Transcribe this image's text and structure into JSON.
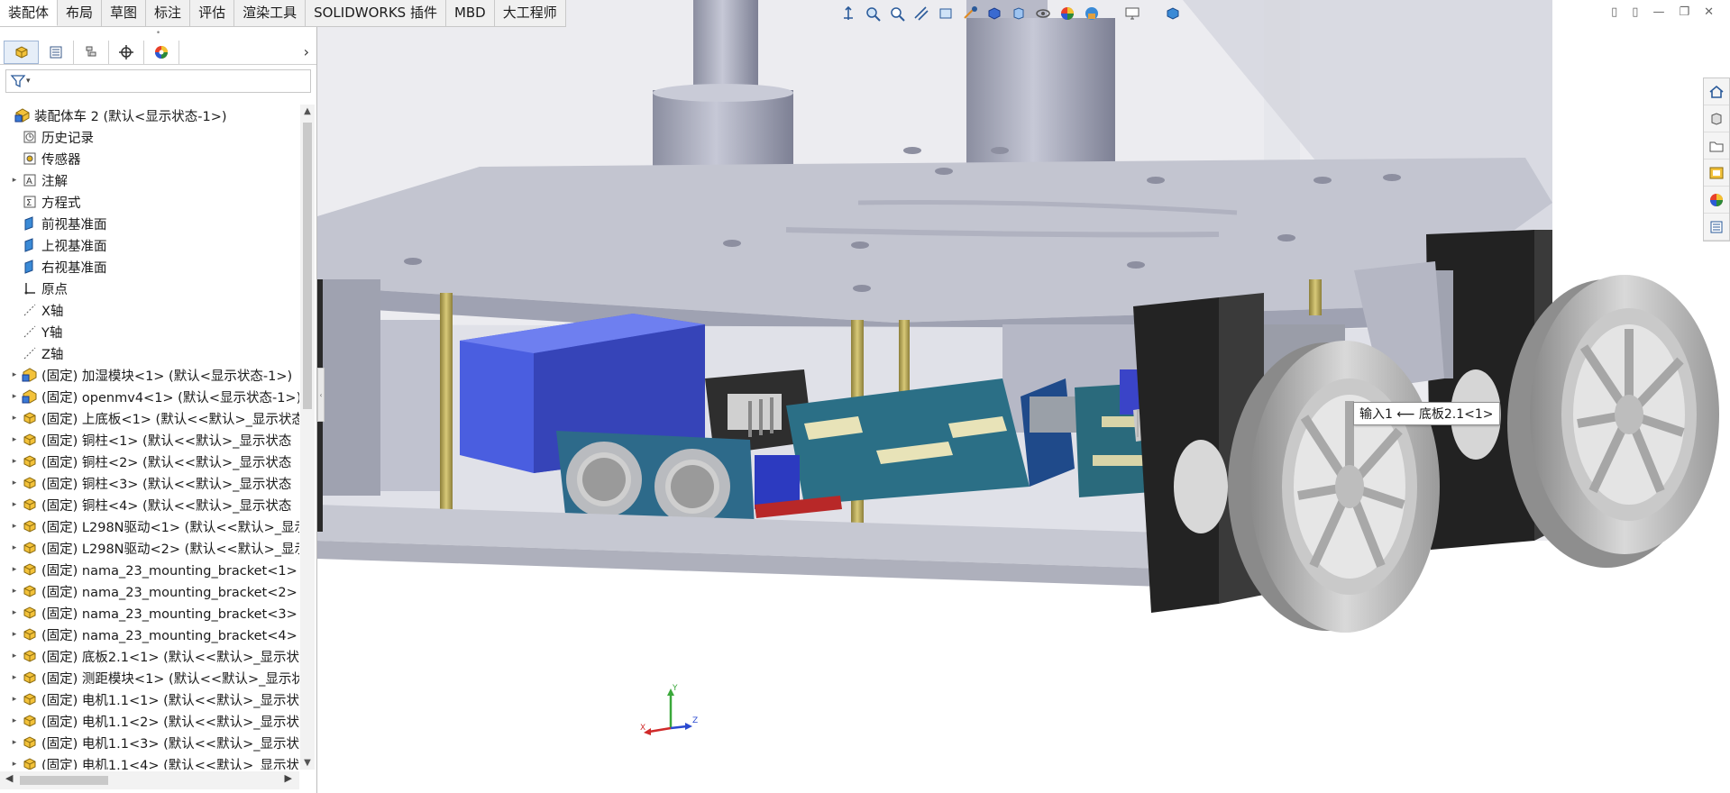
{
  "command_tabs": [
    "装配体",
    "布局",
    "草图",
    "标注",
    "评估",
    "渲染工具",
    "SOLIDWORKS 插件",
    "MBD",
    "大工程师"
  ],
  "active_tab": "装配体",
  "panel_tabs": [
    "feature-manager",
    "property-manager",
    "configuration-manager",
    "dimxpert-manager",
    "display-manager"
  ],
  "tree": {
    "root": "装配体车 2  (默认<显示状态-1>)",
    "items": [
      {
        "label": "历史记录",
        "icon": "history-icon",
        "expandable": false
      },
      {
        "label": "传感器",
        "icon": "sensor-icon",
        "expandable": false
      },
      {
        "label": "注解",
        "icon": "annotation-icon",
        "expandable": true
      },
      {
        "label": "方程式",
        "icon": "equation-icon",
        "expandable": false
      },
      {
        "label": "前视基准面",
        "icon": "plane-icon",
        "expandable": false
      },
      {
        "label": "上视基准面",
        "icon": "plane-icon",
        "expandable": false
      },
      {
        "label": "右视基准面",
        "icon": "plane-icon",
        "expandable": false
      },
      {
        "label": "原点",
        "icon": "origin-icon",
        "expandable": false
      },
      {
        "label": "X轴",
        "icon": "axis-icon",
        "expandable": false
      },
      {
        "label": "Y轴",
        "icon": "axis-icon",
        "expandable": false
      },
      {
        "label": "Z轴",
        "icon": "axis-icon",
        "expandable": false
      },
      {
        "label": "(固定) 加湿模块<1> (默认<显示状态-1>)",
        "icon": "subassembly-icon",
        "expandable": true
      },
      {
        "label": "(固定) openmv4<1> (默认<显示状态-1>)",
        "icon": "subassembly-icon",
        "expandable": true
      },
      {
        "label": "(固定) 上底板<1> (默认<<默认>_显示状态",
        "icon": "part-icon",
        "expandable": true
      },
      {
        "label": "(固定) 铜柱<1> (默认<<默认>_显示状态",
        "icon": "part-icon",
        "expandable": true
      },
      {
        "label": "(固定) 铜柱<2> (默认<<默认>_显示状态",
        "icon": "part-icon",
        "expandable": true
      },
      {
        "label": "(固定) 铜柱<3> (默认<<默认>_显示状态",
        "icon": "part-icon",
        "expandable": true
      },
      {
        "label": "(固定) 铜柱<4> (默认<<默认>_显示状态",
        "icon": "part-icon",
        "expandable": true
      },
      {
        "label": "(固定) L298N驱动<1> (默认<<默认>_显示",
        "icon": "part-icon",
        "expandable": true
      },
      {
        "label": "(固定) L298N驱动<2> (默认<<默认>_显示",
        "icon": "part-icon",
        "expandable": true
      },
      {
        "label": "(固定) nama_23_mounting_bracket<1>",
        "icon": "part-icon",
        "expandable": true
      },
      {
        "label": "(固定) nama_23_mounting_bracket<2>",
        "icon": "part-icon",
        "expandable": true
      },
      {
        "label": "(固定) nama_23_mounting_bracket<3>",
        "icon": "part-icon",
        "expandable": true
      },
      {
        "label": "(固定) nama_23_mounting_bracket<4>",
        "icon": "part-icon",
        "expandable": true
      },
      {
        "label": "(固定) 底板2.1<1> (默认<<默认>_显示状",
        "icon": "part-icon",
        "expandable": true
      },
      {
        "label": "(固定) 测距模块<1> (默认<<默认>_显示状",
        "icon": "part-icon",
        "expandable": true
      },
      {
        "label": "(固定) 电机1.1<1> (默认<<默认>_显示状",
        "icon": "part-icon",
        "expandable": true
      },
      {
        "label": "(固定) 电机1.1<2> (默认<<默认>_显示状",
        "icon": "part-icon",
        "expandable": true
      },
      {
        "label": "(固定) 电机1.1<3> (默认<<默认>_显示状",
        "icon": "part-icon",
        "expandable": true
      },
      {
        "label": "(固定) 电机1.1<4> (默认<<默认>_显示状",
        "icon": "part-icon",
        "expandable": true
      }
    ]
  },
  "tooltip": "输入1 ⟵ 底板2.1<1>",
  "triad": {
    "x": "X",
    "y": "Y",
    "z": "Z"
  },
  "heads_up_toolbar": [
    "zoom-to-fit-icon",
    "zoom-area-icon",
    "previous-view-icon",
    "section-view-icon",
    "dynamic-annotation-icon",
    "view-orientation-icon",
    "display-style-icon",
    "hide-show-icon",
    "edit-appearance-icon",
    "apply-scene-icon",
    "view-settings-icon",
    "display-pane-icon"
  ],
  "task_pane": [
    "home-icon",
    "design-library-icon",
    "file-explorer-icon",
    "view-palette-icon",
    "appearances-icon",
    "custom-properties-icon"
  ],
  "colors": {
    "accent": "#1f6fd1",
    "chassis": "#c8cad4",
    "wheel": "#bdbdbd",
    "sensor_board": "#2d6a8a",
    "blue_box": "#3b4fd6",
    "standoff": "#b9a85a"
  }
}
